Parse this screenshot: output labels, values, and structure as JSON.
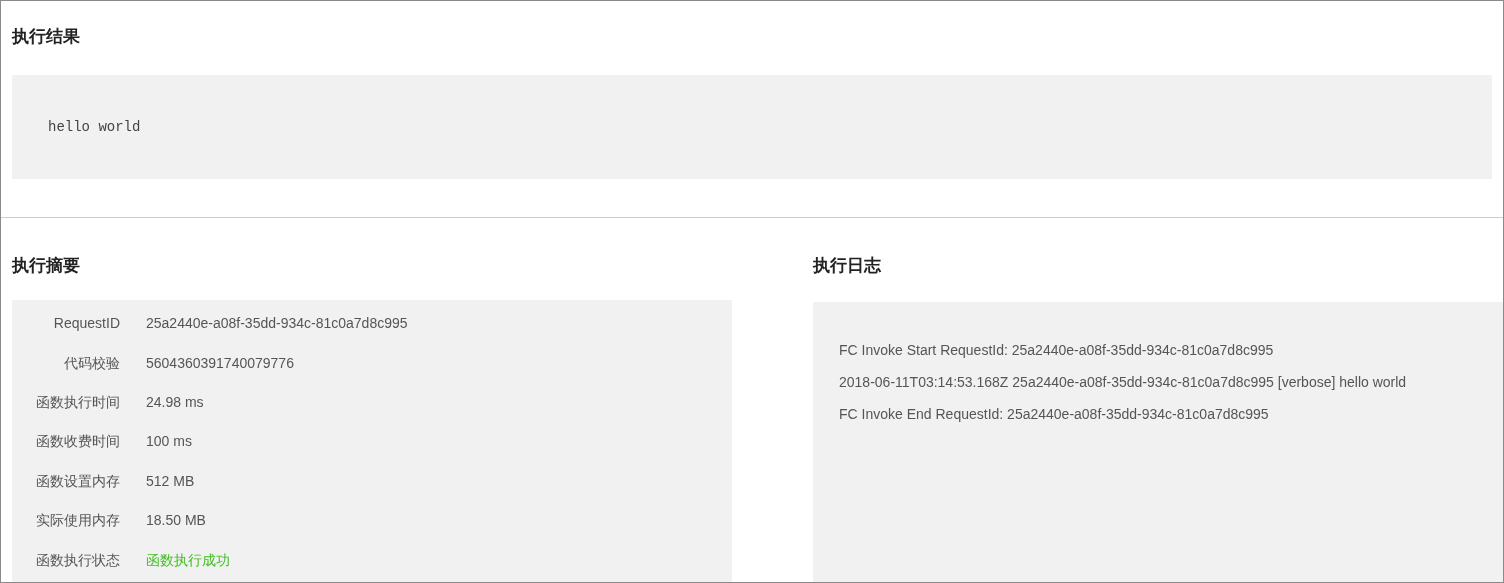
{
  "result": {
    "title": "执行结果",
    "output": "hello world"
  },
  "summary": {
    "title": "执行摘要",
    "rows": [
      {
        "label": "RequestID",
        "value": "25a2440e-a08f-35dd-934c-81c0a7d8c995",
        "success": false
      },
      {
        "label": "代码校验",
        "value": "5604360391740079776",
        "success": false
      },
      {
        "label": "函数执行时间",
        "value": "24.98 ms",
        "success": false
      },
      {
        "label": "函数收费时间",
        "value": "100 ms",
        "success": false
      },
      {
        "label": "函数设置内存",
        "value": "512 MB",
        "success": false
      },
      {
        "label": "实际使用内存",
        "value": "18.50 MB",
        "success": false
      },
      {
        "label": "函数执行状态",
        "value": "函数执行成功",
        "success": true
      }
    ]
  },
  "log": {
    "title": "执行日志",
    "lines": [
      "FC Invoke Start RequestId: 25a2440e-a08f-35dd-934c-81c0a7d8c995",
      "2018-06-11T03:14:53.168Z 25a2440e-a08f-35dd-934c-81c0a7d8c995 [verbose] hello world",
      "FC Invoke End RequestId: 25a2440e-a08f-35dd-934c-81c0a7d8c995"
    ]
  }
}
